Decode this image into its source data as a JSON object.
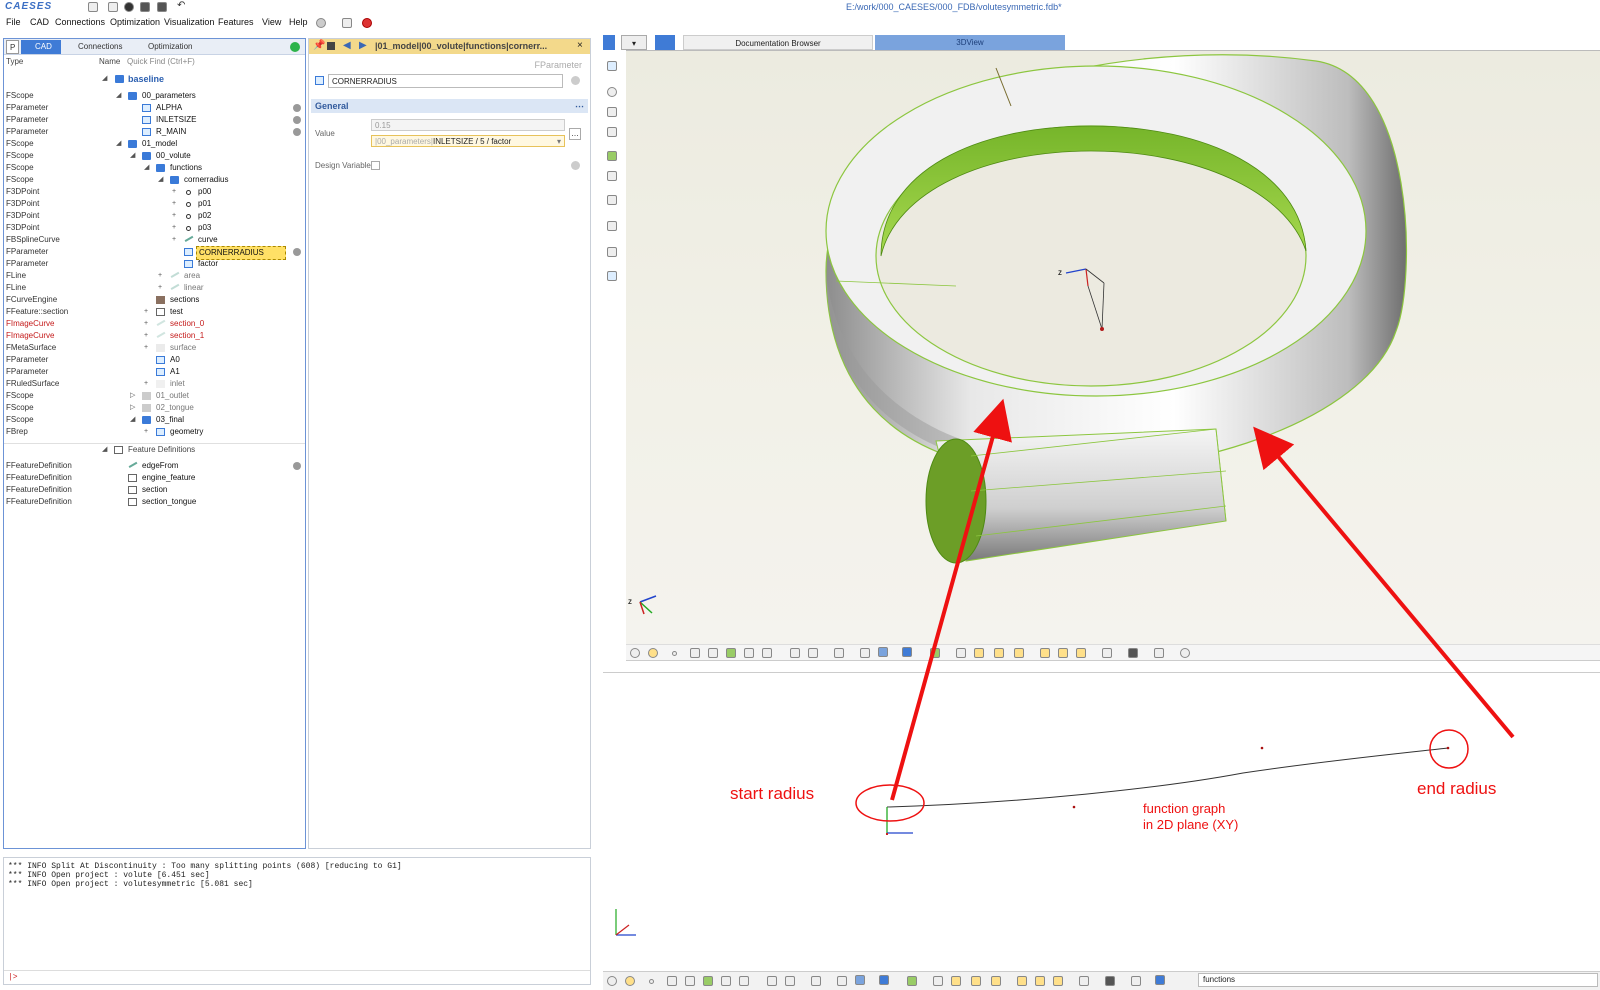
{
  "app": {
    "logo": "CAESES",
    "file_path": "E:/work/000_CAESES/000_FDB/volutesymmetric.fdb*"
  },
  "menu": [
    "File",
    "CAD",
    "Connections",
    "Optimization",
    "Visualization",
    "Features",
    "View",
    "Help"
  ],
  "left_tabs": {
    "p": "P",
    "cad": "CAD",
    "connections": "Connections",
    "optimization": "Optimization"
  },
  "tree_header": {
    "type": "Type",
    "name": "Name",
    "quick_find": "Quick Find (Ctrl+F)"
  },
  "tree": [
    {
      "type": "",
      "name": "baseline"
    },
    {
      "type": "FScope",
      "name": "00_parameters"
    },
    {
      "type": "FParameter",
      "name": "ALPHA"
    },
    {
      "type": "FParameter",
      "name": "INLETSIZE"
    },
    {
      "type": "FParameter",
      "name": "R_MAIN"
    },
    {
      "type": "FScope",
      "name": "01_model"
    },
    {
      "type": "FScope",
      "name": "00_volute"
    },
    {
      "type": "FScope",
      "name": "functions"
    },
    {
      "type": "FScope",
      "name": "cornerradius"
    },
    {
      "type": "F3DPoint",
      "name": "p00"
    },
    {
      "type": "F3DPoint",
      "name": "p01"
    },
    {
      "type": "F3DPoint",
      "name": "p02"
    },
    {
      "type": "F3DPoint",
      "name": "p03"
    },
    {
      "type": "FBSplineCurve",
      "name": "curve"
    },
    {
      "type": "FParameter",
      "name": "CORNERRADIUS"
    },
    {
      "type": "FParameter",
      "name": "factor"
    },
    {
      "type": "FLine",
      "name": "area"
    },
    {
      "type": "FLine",
      "name": "linear"
    },
    {
      "type": "FCurveEngine",
      "name": "sections"
    },
    {
      "type": "FFeature::section",
      "name": "test"
    },
    {
      "type": "FImageCurve",
      "name": "section_0"
    },
    {
      "type": "FImageCurve",
      "name": "section_1"
    },
    {
      "type": "FMetaSurface",
      "name": "surface"
    },
    {
      "type": "FParameter",
      "name": "A0"
    },
    {
      "type": "FParameter",
      "name": "A1"
    },
    {
      "type": "FRuledSurface",
      "name": "inlet"
    },
    {
      "type": "FScope",
      "name": "01_outlet"
    },
    {
      "type": "FScope",
      "name": "02_tongue"
    },
    {
      "type": "FScope",
      "name": "03_final"
    },
    {
      "type": "FBrep",
      "name": "geometry"
    },
    {
      "type": "",
      "name": "Feature Definitions"
    },
    {
      "type": "FFeatureDefinition",
      "name": "edgeFrom"
    },
    {
      "type": "FFeatureDefinition",
      "name": "engine_feature"
    },
    {
      "type": "FFeatureDefinition",
      "name": "section"
    },
    {
      "type": "FFeatureDefinition",
      "name": "section_tongue"
    }
  ],
  "editor": {
    "path": "|01_model|00_volute|functions|cornerr...",
    "class_label": "FParameter",
    "name": "CORNERRADIUS",
    "section": "General",
    "value_label": "Value",
    "value_computed": "0.15",
    "value_prefix": "|00_parameters|",
    "value_expr": "INLETSIZE / 5 / factor",
    "design_variable_label": "Design Variable"
  },
  "console": {
    "lines": [
      "*** INFO Split At Discontinuity : Too many splitting points (608) [reducing to G1]",
      "*** INFO Open project : volute [6.451 sec]",
      "*** INFO Open project : volutesymmetric [5.081 sec]"
    ],
    "prompt": "|>"
  },
  "right_tabs": {
    "doc": "Documentation Browser",
    "view3d": "3DView"
  },
  "annotations": {
    "start": "start radius",
    "end": "end radius",
    "graph_line1": "function graph",
    "graph_line2": "in 2D plane (XY)"
  },
  "search_value": "functions",
  "colors": {
    "accent": "#3f7bd6",
    "annotation": "#e11111",
    "volute_green": "#8cc63f",
    "editor_bar": "#f3d98b"
  }
}
